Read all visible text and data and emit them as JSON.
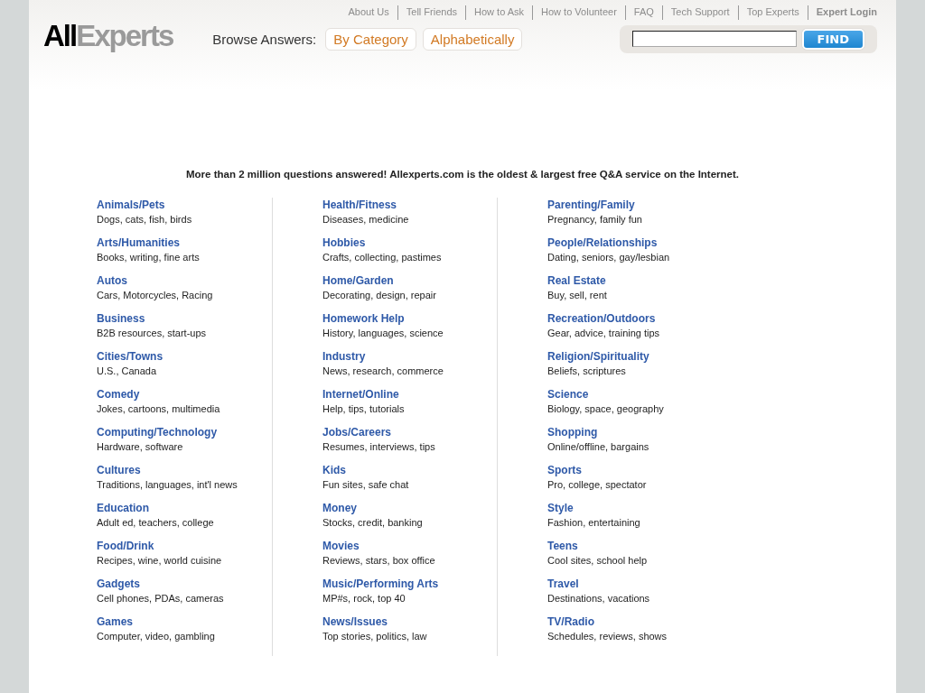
{
  "top_nav": [
    {
      "label": "About Us",
      "bold": false
    },
    {
      "label": "Tell Friends",
      "bold": false
    },
    {
      "label": "How to Ask",
      "bold": false
    },
    {
      "label": "How to Volunteer",
      "bold": false
    },
    {
      "label": "FAQ",
      "bold": false
    },
    {
      "label": "Tech Support",
      "bold": false
    },
    {
      "label": "Top Experts",
      "bold": false
    },
    {
      "label": "Expert Login",
      "bold": true
    }
  ],
  "logo": {
    "first": "All",
    "second": "Experts"
  },
  "browse": {
    "label": "Browse Answers:",
    "options": [
      "By Category",
      "Alphabetically"
    ]
  },
  "search": {
    "button": "FIND"
  },
  "tagline": "More than 2 million questions answered! Allexperts.com is the oldest & largest free Q&A service on the Internet.",
  "columns": [
    [
      {
        "title": "Animals/Pets",
        "desc": "Dogs, cats, fish, birds"
      },
      {
        "title": "Arts/Humanities",
        "desc": "Books, writing, fine arts"
      },
      {
        "title": "Autos",
        "desc": "Cars, Motorcycles, Racing"
      },
      {
        "title": "Business",
        "desc": "B2B resources, start-ups"
      },
      {
        "title": "Cities/Towns",
        "desc": "U.S., Canada"
      },
      {
        "title": "Comedy",
        "desc": "Jokes, cartoons, multimedia"
      },
      {
        "title": "Computing/Technology",
        "desc": "Hardware, software"
      },
      {
        "title": "Cultures",
        "desc": "Traditions, languages, int'l news"
      },
      {
        "title": "Education",
        "desc": "Adult ed, teachers, college"
      },
      {
        "title": "Food/Drink",
        "desc": "Recipes, wine, world cuisine"
      },
      {
        "title": "Gadgets",
        "desc": "Cell phones, PDAs, cameras"
      },
      {
        "title": "Games",
        "desc": "Computer, video, gambling"
      }
    ],
    [
      {
        "title": "Health/Fitness",
        "desc": "Diseases, medicine"
      },
      {
        "title": "Hobbies",
        "desc": "Crafts, collecting, pastimes"
      },
      {
        "title": "Home/Garden",
        "desc": "Decorating, design, repair"
      },
      {
        "title": "Homework Help",
        "desc": "History, languages, science"
      },
      {
        "title": "Industry",
        "desc": "News, research, commerce"
      },
      {
        "title": "Internet/Online",
        "desc": "Help, tips, tutorials"
      },
      {
        "title": "Jobs/Careers",
        "desc": "Resumes, interviews, tips"
      },
      {
        "title": "Kids",
        "desc": "Fun sites, safe chat"
      },
      {
        "title": "Money",
        "desc": "Stocks, credit, banking"
      },
      {
        "title": "Movies",
        "desc": "Reviews, stars, box office"
      },
      {
        "title": "Music/Performing Arts",
        "desc": "MP#s, rock, top 40"
      },
      {
        "title": "News/Issues",
        "desc": "Top stories, politics, law"
      }
    ],
    [
      {
        "title": "Parenting/Family",
        "desc": "Pregnancy, family fun"
      },
      {
        "title": "People/Relationships",
        "desc": "Dating, seniors, gay/lesbian"
      },
      {
        "title": "Real Estate",
        "desc": "Buy, sell, rent"
      },
      {
        "title": "Recreation/Outdoors",
        "desc": "Gear, advice, training tips"
      },
      {
        "title": "Religion/Spirituality",
        "desc": "Beliefs, scriptures"
      },
      {
        "title": "Science",
        "desc": "Biology, space, geography"
      },
      {
        "title": "Shopping",
        "desc": "Online/offline, bargains"
      },
      {
        "title": "Sports",
        "desc": "Pro, college, spectator"
      },
      {
        "title": "Style",
        "desc": "Fashion, entertaining"
      },
      {
        "title": "Teens",
        "desc": "Cool sites, school help"
      },
      {
        "title": "Travel",
        "desc": "Destinations, vacations"
      },
      {
        "title": "TV/Radio",
        "desc": "Schedules, reviews, shows"
      }
    ]
  ]
}
